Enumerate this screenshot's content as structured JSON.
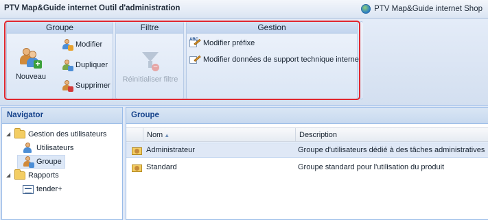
{
  "titlebar": {
    "title": "PTV Map&Guide internet Outil d'administration",
    "shop_link": "PTV Map&Guide internet Shop"
  },
  "ribbon": {
    "groups": {
      "groupe": {
        "title": "Groupe",
        "nouveau": "Nouveau",
        "modifier": "Modifier",
        "dupliquer": "Dupliquer",
        "supprimer": "Supprimer"
      },
      "filtre": {
        "title": "Filtre",
        "reset": "Réinitialiser filtre"
      },
      "gestion": {
        "title": "Gestion",
        "modifier_prefixe": "Modifier préfixe",
        "modifier_support": "Modifier données de support technique interne"
      }
    }
  },
  "navigator": {
    "title": "Navigator",
    "items": [
      {
        "label": "Gestion des utilisateurs"
      },
      {
        "label": "Utilisateurs"
      },
      {
        "label": "Groupe"
      },
      {
        "label": "Rapports"
      },
      {
        "label": "tender+"
      }
    ]
  },
  "main": {
    "title": "Groupe",
    "columns": {
      "name": "Nom",
      "description": "Description"
    },
    "rows": [
      {
        "name": "Administrateur",
        "description": "Groupe d'utilisateurs dédié à des tâches administratives"
      },
      {
        "name": "Standard",
        "description": "Groupe standard pour l'utilisation du produit"
      }
    ]
  },
  "colors": {
    "highlight": "#e0262e",
    "panel_header_text": "#15428b",
    "ribbon_bg": "#dbe6f5"
  }
}
